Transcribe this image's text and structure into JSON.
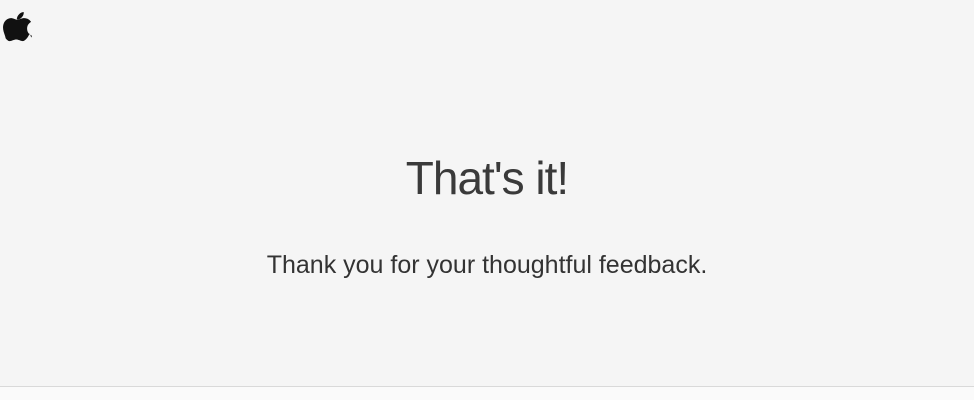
{
  "header": {
    "logo_icon": "apple-icon"
  },
  "main": {
    "headline": "That's it!",
    "message": "Thank you for your thoughtful feedback."
  },
  "colors": {
    "background": "#f5f5f5",
    "text": "#333333",
    "divider": "#d9d9d9"
  }
}
